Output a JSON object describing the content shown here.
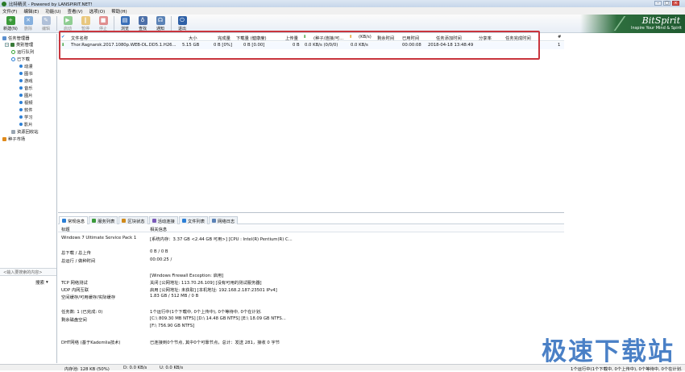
{
  "window": {
    "title": "比特精灵 - Powered by LANSPIRIT.NET!",
    "controls": [
      "–",
      "□",
      "×"
    ]
  },
  "menu": [
    "文件(F)",
    "编辑(E)",
    "功能(U)",
    "查看(V)",
    "选项(O)",
    "帮助(H)"
  ],
  "toolbar": [
    {
      "label": "新建(N)",
      "icon": "new-icon",
      "color": "#3a9a3a",
      "glyph": "+"
    },
    {
      "label": "删除",
      "icon": "delete-icon",
      "color": "#2e78c8",
      "glyph": "✕"
    },
    {
      "label": "编辑",
      "icon": "edit-icon",
      "color": "#7a96bf",
      "glyph": "✎"
    },
    {
      "label": "启动",
      "icon": "start-icon",
      "color": "#3fae3f",
      "glyph": "▶"
    },
    {
      "label": "暂停",
      "icon": "pause-icon",
      "color": "#e0a21a",
      "glyph": "‖"
    },
    {
      "label": "停止",
      "icon": "stop-icon",
      "color": "#d23a3a",
      "glyph": "■"
    },
    {
      "label": "浏览",
      "icon": "browse-icon",
      "color": "#3a6fb8",
      "glyph": "▤"
    },
    {
      "label": "查找",
      "icon": "search-icon",
      "color": "#4c6fa8",
      "glyph": "♁"
    },
    {
      "label": "通知",
      "icon": "notify-icon",
      "color": "#5a82b6",
      "glyph": "☊"
    },
    {
      "label": "退出",
      "icon": "exit-icon",
      "color": "#2d5fa6",
      "glyph": "⏻"
    }
  ],
  "logo": {
    "name": "BitSpirit",
    "tagline": "Inspire Your Mind & Spirit"
  },
  "sidebar": {
    "root": "任务管理器",
    "items": [
      {
        "label": "类别管理"
      },
      {
        "label": "运行队列"
      },
      {
        "label": "已下载"
      },
      {
        "label": "动漫"
      },
      {
        "label": "图书"
      },
      {
        "label": "游戏"
      },
      {
        "label": "音乐"
      },
      {
        "label": "图片"
      },
      {
        "label": "视频"
      },
      {
        "label": "软件"
      },
      {
        "label": "学习"
      },
      {
        "label": "影片"
      },
      {
        "label": "资源回收站"
      },
      {
        "label": "种子市场"
      }
    ],
    "search_placeholder": "<输入要搜索的内容>",
    "search_button": "搜索"
  },
  "list": {
    "headers": [
      "文件名称",
      "大小",
      "完成量",
      "下载量 (健康度)",
      "上传量",
      "(种子/连接/可...",
      "(KB/s)",
      "剩余时间",
      "已用时间",
      "任务添加时间",
      "分享率",
      "任务完成时间",
      "#"
    ],
    "rows": [
      {
        "name": "Thor.Ragnarok.2017.1080p.WEB-DL.DD5.1.H26...",
        "size": "5.15 GB",
        "done": "0 B [0%]",
        "downloaded": "0 B [0.00]",
        "uploaded": "0 B",
        "peers": "0.0 KB/s (0/0/0)",
        "speed": "0.0 KB/s",
        "remaining": "",
        "elapsed": "00:00:08",
        "added": "2018-04-18 13:48:49",
        "ratio": "",
        "completed": "",
        "num": "1"
      }
    ]
  },
  "tabs": [
    "常规信息",
    "服务列表",
    "区块状态",
    "活动连接",
    "文件列表",
    "网络日志"
  ],
  "info": {
    "headers": [
      "标题",
      "相关信息"
    ],
    "rows": [
      {
        "label": "Windows 7 Ultimate Service Pack 1",
        "value": "[系统内存：3.37 GB <2.44 GB 可用>] [CPU : Intel(R) Pentium(R) C..."
      },
      {
        "label": "总下载 / 总上传",
        "value": "0 B / 0 B"
      },
      {
        "label": "总运行 / 做种时间",
        "value": "00:00:25 /"
      },
      {
        "label": "",
        "value": "[Windows Firewall Exception: 启用]"
      },
      {
        "label": "TCP 网络测试",
        "value": "关闭 [公网地址: 113.70.26.109] [没有可用的测试服务器]"
      },
      {
        "label": "UDP 内网互联",
        "value": "启用 [公网地址: 未获取] [本机地址: 192.168.2.187:23501 IPv4]"
      },
      {
        "label": "空间缓存/可用缓存/实际缓存",
        "value": "1.83 GB / 512 MB / 0 B"
      },
      {
        "label": "任务数: 1 (已完成: 0)",
        "value": "1个运行中(1个下载中, 0个上传中), 0个等待中, 0个在计划."
      },
      {
        "label": "剩余磁盘空间",
        "value": "[C:\\ 809.30 MB  NTFS]   [D:\\ 14.48 GB  NTFS]   [E:\\ 18.09 GB  NTFS..."
      },
      {
        "label": "",
        "value": "[F:\\ 756.90 GB  NTFS]"
      },
      {
        "label": "DHT网络 (基于Kademlia技术)",
        "value": "已连接到0个节点, 其中0个可靠节点，总计：发送 281，接收 0 字节"
      }
    ]
  },
  "status": {
    "mem": "内存池: 128 KB (50%)",
    "down": "D: 0.0 KB/s",
    "up": "U: 0.0 KB/s",
    "tasks": "1个运行中(1个下载中, 0个上传中), 0个等待中, 0个在计划."
  },
  "watermark": "极速下载站"
}
